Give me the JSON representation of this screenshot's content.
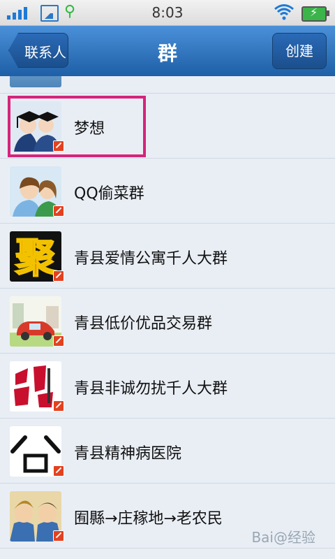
{
  "status_bar": {
    "time": "8:03"
  },
  "header": {
    "back_label": "联系人",
    "title": "群",
    "create_label": "创建"
  },
  "groups": [
    {
      "name": "梦想",
      "icon": "graduates-avatar-icon"
    },
    {
      "name": "QQ偷菜群",
      "icon": "couple-avatar-icon"
    },
    {
      "name": "青县爱情公寓千人大群",
      "icon": "ju-character-avatar-icon"
    },
    {
      "name": "青县低价优品交易群",
      "icon": "red-car-avatar-icon"
    },
    {
      "name": "青县非诚勿扰千人大群",
      "icon": "tv-show-logo-avatar-icon"
    },
    {
      "name": "青县精神病医院",
      "icon": "face-avatar-icon"
    },
    {
      "name": "囿縣→庄稼地→老农民",
      "icon": "cartoon-couple-avatar-icon"
    }
  ],
  "watermark": "Bai@经验",
  "colors": {
    "header_blue": "#1e5fa6",
    "list_bg": "#e9eef5",
    "highlight": "#d6247a",
    "badge": "#e4411f"
  }
}
